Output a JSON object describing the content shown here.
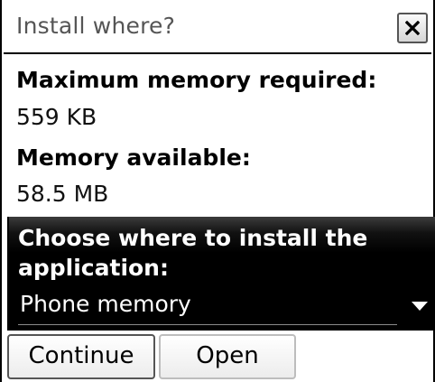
{
  "dialog": {
    "title": "Install where?",
    "close_icon": "close-icon"
  },
  "memory_required": {
    "label": "Maximum memory required:",
    "value": "559 KB"
  },
  "memory_available": {
    "label": "Memory available:",
    "value": "58.5 MB"
  },
  "install_location": {
    "prompt": "Choose where to install the application:",
    "selected": "Phone memory",
    "arrow_icon": "dropdown-arrow-icon"
  },
  "buttons": {
    "continue_label": "Continue",
    "open_label": "Open"
  },
  "colors": {
    "chooser_background": "#000000",
    "chooser_text": "#ffffff",
    "title_text": "#555555"
  }
}
